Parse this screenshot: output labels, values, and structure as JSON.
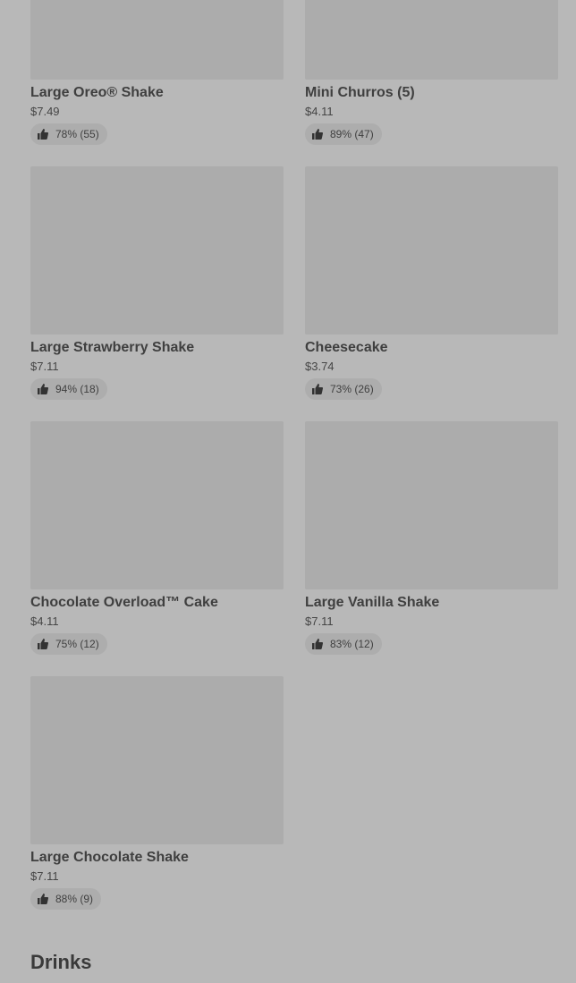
{
  "items": [
    {
      "name": "Large Oreo® Shake",
      "price": "$7.49",
      "rating": "78% (55)"
    },
    {
      "name": "Mini Churros (5)",
      "price": "$4.11",
      "rating": "89% (47)"
    },
    {
      "name": "Large Strawberry Shake",
      "price": "$7.11",
      "rating": "94% (18)"
    },
    {
      "name": "Cheesecake",
      "price": "$3.74",
      "rating": "73% (26)"
    },
    {
      "name": "Chocolate Overload™ Cake",
      "price": "$4.11",
      "rating": "75% (12)"
    },
    {
      "name": "Large Vanilla Shake",
      "price": "$7.11",
      "rating": "83% (12)"
    },
    {
      "name": "Large Chocolate Shake",
      "price": "$7.11",
      "rating": "88% (9)"
    }
  ],
  "section": {
    "title": "Drinks"
  },
  "icons": {
    "rating": "thumbs-up-icon"
  }
}
